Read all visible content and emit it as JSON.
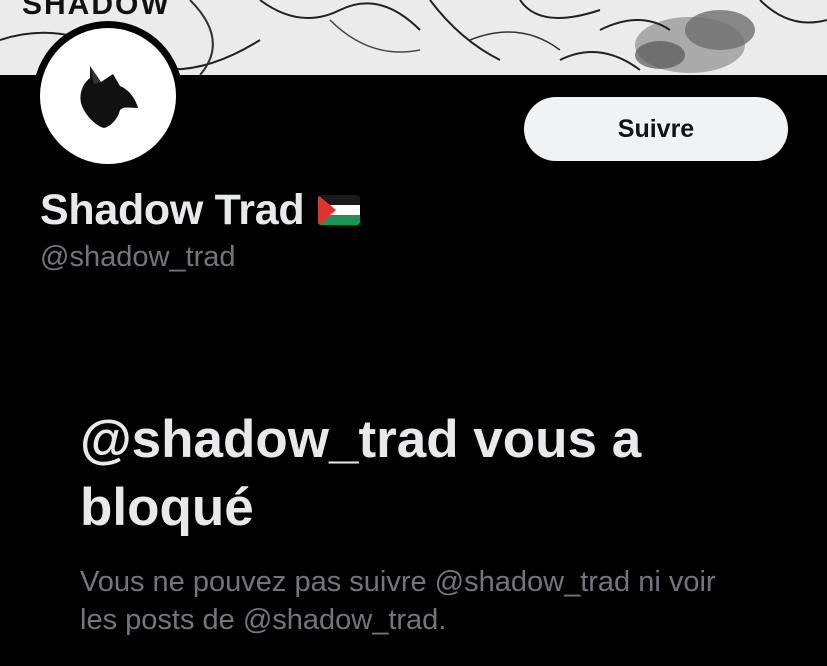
{
  "colors": {
    "background": "#000000",
    "text_primary": "#e7e9ea",
    "text_secondary": "#71767b",
    "button_bg": "#eff3f4",
    "button_text": "#0f1419"
  },
  "banner": {
    "text": "SHADOW"
  },
  "profile": {
    "avatar_icon": "wolf-head-icon",
    "display_name": "Shadow Trad",
    "flag_icon": "palestine-flag-icon",
    "handle": "@shadow_trad",
    "follow_label": "Suivre"
  },
  "blocked": {
    "title": "@shadow_trad vous a bloqué",
    "description": "Vous ne pouvez pas suivre @shadow_trad ni voir les posts de @shadow_trad."
  }
}
